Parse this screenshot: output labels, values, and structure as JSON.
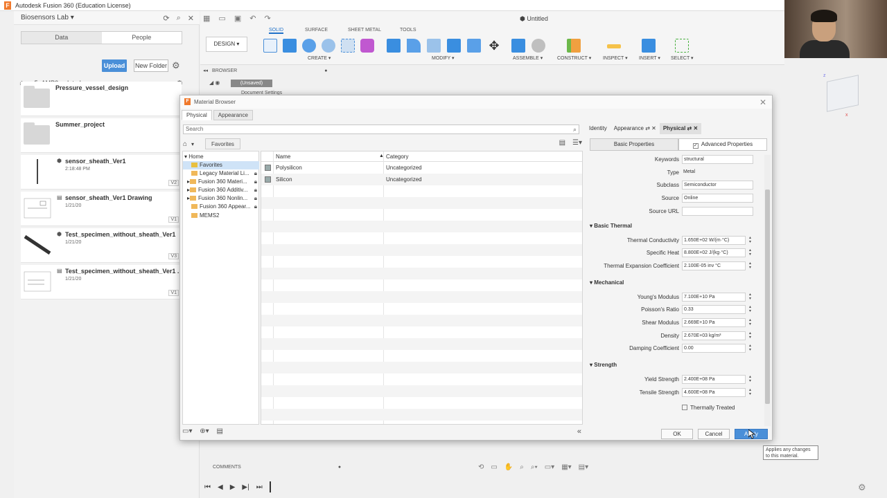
{
  "window": {
    "title": "Autodesk Fusion 360 (Education License)",
    "doc_title": "Untitled"
  },
  "data_panel": {
    "project": "Biosensors Lab",
    "tabs": [
      "Data",
      "People"
    ],
    "upload": "Upload",
    "new_folder": "New Folder",
    "breadcrumb": "5_AMP3_related",
    "items": [
      {
        "name": "Pressure_vessel_design",
        "date": "",
        "version": ""
      },
      {
        "name": "Summer_project",
        "date": "",
        "version": ""
      },
      {
        "name": "sensor_sheath_Ver1",
        "date": "2:18:48 PM",
        "version": "V2"
      },
      {
        "name": "sensor_sheath_Ver1 Drawing",
        "date": "1/21/20",
        "version": "V1"
      },
      {
        "name": "Test_specimen_without_sheath_Ver1",
        "date": "1/21/20",
        "version": "V3"
      },
      {
        "name": "Test_specimen_without_sheath_Ver1 ...",
        "date": "1/21/20",
        "version": "V1"
      }
    ]
  },
  "toolbar": {
    "design": "DESIGN",
    "tabs": [
      "SOLID",
      "SURFACE",
      "SHEET METAL",
      "TOOLS"
    ],
    "groups": [
      "CREATE",
      "MODIFY",
      "ASSEMBLE",
      "CONSTRUCT",
      "INSPECT",
      "INSERT",
      "SELECT"
    ]
  },
  "browser": {
    "label": "BROWSER",
    "unsaved": "(Unsaved)",
    "doc_settings": "Document Settings"
  },
  "dialog": {
    "title": "Material Browser",
    "tabs": [
      "Physical",
      "Appearance"
    ],
    "search_placeholder": "Search",
    "favorites": "Favorites",
    "tree": [
      {
        "label": "Home",
        "indent": 0
      },
      {
        "label": "Favorites",
        "indent": 1
      },
      {
        "label": "Legacy Material Li...",
        "indent": 1
      },
      {
        "label": "Fusion 360 Materi...",
        "indent": 1
      },
      {
        "label": "Fusion 360 Additiv...",
        "indent": 1
      },
      {
        "label": "Fusion 360 Nonlin...",
        "indent": 1
      },
      {
        "label": "Fusion 360 Appear...",
        "indent": 1
      },
      {
        "label": "MEMS2",
        "indent": 1
      }
    ],
    "columns": {
      "name": "Name",
      "category": "Category"
    },
    "rows": [
      {
        "name": "Polysilicon",
        "category": "Uncategorized"
      },
      {
        "name": "Silicon",
        "category": "Uncategorized"
      }
    ],
    "right_tabs": [
      "Identity",
      "Appearance",
      "Physical"
    ],
    "sub_tabs": {
      "basic": "Basic Properties",
      "advanced": "Advanced Properties"
    },
    "info": [
      {
        "label": "Keywords",
        "value": "structural",
        "box": true
      },
      {
        "label": "Type",
        "value": "Metal",
        "box": false
      },
      {
        "label": "Subclass",
        "value": "Semiconductor",
        "box": true
      },
      {
        "label": "Source",
        "value": "Online",
        "box": true
      },
      {
        "label": "Source URL",
        "value": "",
        "box": true
      }
    ],
    "sections": [
      {
        "title": "Basic Thermal",
        "props": [
          {
            "label": "Thermal Conductivity",
            "value": "1.650E+02 W/(m·°C)"
          },
          {
            "label": "Specific Heat",
            "value": "8.800E+02 J/(kg·°C)"
          },
          {
            "label": "Thermal Expansion Coefficient",
            "value": "2.100E-05 inv °C"
          }
        ]
      },
      {
        "title": "Mechanical",
        "props": [
          {
            "label": "Young's Modulus",
            "value": "7.100E+10 Pa"
          },
          {
            "label": "Poisson's Ratio",
            "value": "0.33"
          },
          {
            "label": "Shear Modulus",
            "value": "2.669E+10 Pa"
          },
          {
            "label": "Density",
            "value": "2.670E+03 kg/m³"
          },
          {
            "label": "Damping Coefficient",
            "value": "0.00"
          }
        ]
      },
      {
        "title": "Strength",
        "props": [
          {
            "label": "Yield Strength",
            "value": "2.400E+08 Pa"
          },
          {
            "label": "Tensile Strength",
            "value": "4.600E+08 Pa"
          }
        ]
      }
    ],
    "thermally_treated": "Thermally Treated",
    "buttons": {
      "ok": "OK",
      "cancel": "Cancel",
      "apply": "Apply"
    },
    "tooltip": "Applies any changes to this material."
  },
  "comments": "COMMENTS"
}
